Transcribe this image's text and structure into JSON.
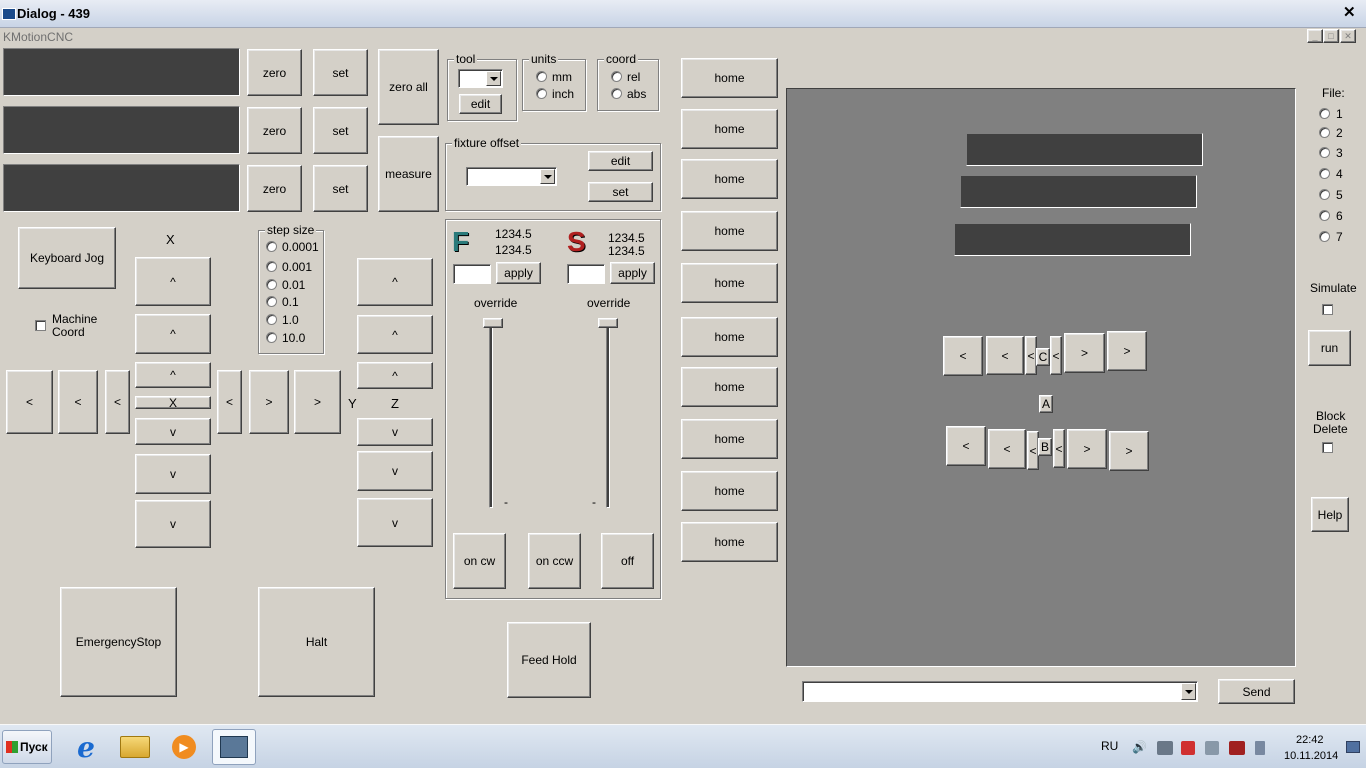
{
  "window": {
    "title": "Dialog -  439",
    "app_title": "KMotionCNC",
    "close": "✕",
    "min": "_",
    "max": "□"
  },
  "axes": {
    "zero_label": "zero",
    "set_label": "set",
    "zero_all": "zero all",
    "measure": "measure"
  },
  "tool": {
    "group": "tool",
    "edit": "edit"
  },
  "units": {
    "group": "units",
    "mm": "mm",
    "inch": "inch"
  },
  "coord": {
    "group": "coord",
    "rel": "rel",
    "abs": "abs"
  },
  "fixture": {
    "group": "fixture offset",
    "edit": "edit",
    "set": "set"
  },
  "home_label": "home",
  "jog": {
    "keyboard_jog": "Keyboard Jog",
    "machine_coord_1": "Machine",
    "machine_coord_2": "Coord",
    "x_label": "X",
    "y_label": "Y",
    "z_label": "Z",
    "up": "^",
    "down": "v",
    "left": "<",
    "right": ">"
  },
  "step_size": {
    "group": "step size",
    "options": [
      "0.0001",
      "0.001",
      "0.01",
      "0.1",
      "1.0",
      "10.0"
    ]
  },
  "feed": {
    "icon": "F",
    "val1": "1234.5",
    "val2": "1234.5",
    "apply": "apply",
    "override": "override",
    "minus": "-"
  },
  "spindle": {
    "icon": "S",
    "val1": "1234.5",
    "val2": "1234.5",
    "apply": "apply",
    "override": "override",
    "minus": "-",
    "on_cw": "on cw",
    "on_ccw": "on ccw",
    "off": "off"
  },
  "buttons": {
    "estop": "EmergencyStop",
    "halt": "Halt",
    "feed_hold": "Feed Hold",
    "send": "Send"
  },
  "file": {
    "label": "File:",
    "options": [
      "1",
      "2",
      "3",
      "4",
      "5",
      "6",
      "7"
    ]
  },
  "simulate": "Simulate",
  "run": "run",
  "block_delete_1": "Block",
  "block_delete_2": "Delete",
  "help": "Help",
  "panel_c": "C",
  "panel_a": "A",
  "panel_b": "B",
  "taskbar": {
    "start": "Пуск",
    "lang": "RU",
    "time": "22:42",
    "date": "10.11.2014"
  },
  "colors": {
    "dro_bg": "#404040",
    "panel_bg": "#808080",
    "feed_icon": "#2a7a7a",
    "spindle_icon": "#b02020"
  }
}
